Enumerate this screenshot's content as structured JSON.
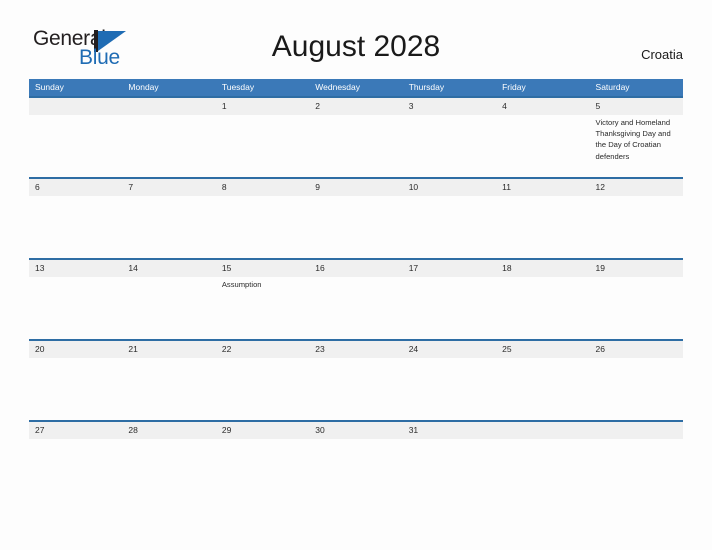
{
  "brand": {
    "name_part1": "General",
    "name_part2": "Blue",
    "logo_icon": "flag-triangle-icon",
    "accent_color": "#1f6cb4"
  },
  "header": {
    "title": "August 2028",
    "country": "Croatia"
  },
  "colors": {
    "header_blue": "#3b79b8",
    "row_rule_blue": "#2e6da4",
    "date_band_gray": "#f0f0f0",
    "page_background": "#fdfdfd",
    "text_dark": "#2b2b2b"
  },
  "calendar": {
    "weekdays": [
      "Sunday",
      "Monday",
      "Tuesday",
      "Wednesday",
      "Thursday",
      "Friday",
      "Saturday"
    ],
    "weeks": [
      [
        {
          "date": "",
          "events": []
        },
        {
          "date": "",
          "events": []
        },
        {
          "date": "1",
          "events": []
        },
        {
          "date": "2",
          "events": []
        },
        {
          "date": "3",
          "events": []
        },
        {
          "date": "4",
          "events": []
        },
        {
          "date": "5",
          "events": [
            "Victory and Homeland Thanksgiving Day and the Day of Croatian defenders"
          ]
        }
      ],
      [
        {
          "date": "6",
          "events": []
        },
        {
          "date": "7",
          "events": []
        },
        {
          "date": "8",
          "events": []
        },
        {
          "date": "9",
          "events": []
        },
        {
          "date": "10",
          "events": []
        },
        {
          "date": "11",
          "events": []
        },
        {
          "date": "12",
          "events": []
        }
      ],
      [
        {
          "date": "13",
          "events": []
        },
        {
          "date": "14",
          "events": []
        },
        {
          "date": "15",
          "events": [
            "Assumption"
          ]
        },
        {
          "date": "16",
          "events": []
        },
        {
          "date": "17",
          "events": []
        },
        {
          "date": "18",
          "events": []
        },
        {
          "date": "19",
          "events": []
        }
      ],
      [
        {
          "date": "20",
          "events": []
        },
        {
          "date": "21",
          "events": []
        },
        {
          "date": "22",
          "events": []
        },
        {
          "date": "23",
          "events": []
        },
        {
          "date": "24",
          "events": []
        },
        {
          "date": "25",
          "events": []
        },
        {
          "date": "26",
          "events": []
        }
      ],
      [
        {
          "date": "27",
          "events": []
        },
        {
          "date": "28",
          "events": []
        },
        {
          "date": "29",
          "events": []
        },
        {
          "date": "30",
          "events": []
        },
        {
          "date": "31",
          "events": []
        },
        {
          "date": "",
          "events": []
        },
        {
          "date": "",
          "events": []
        }
      ]
    ]
  }
}
